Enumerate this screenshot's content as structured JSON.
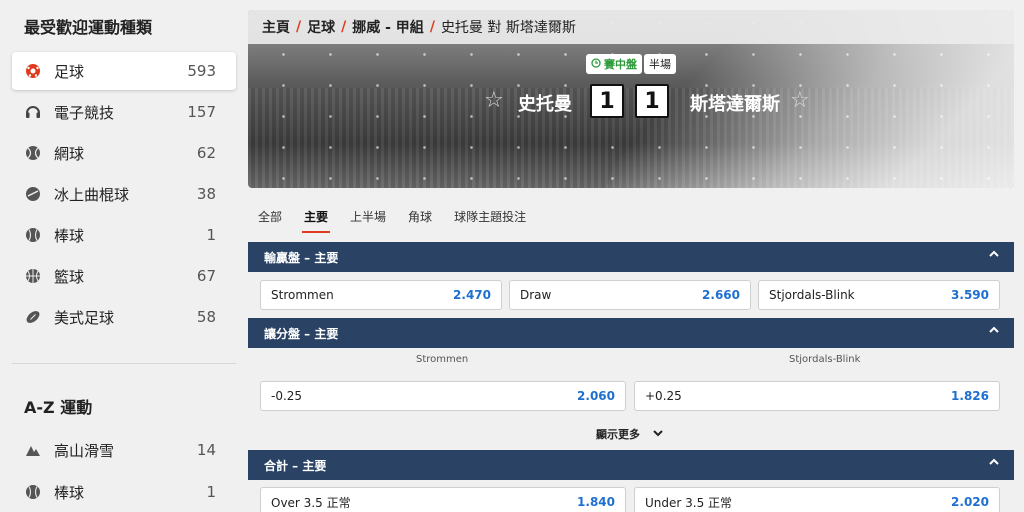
{
  "sidebar": {
    "popular_title": "最受歡迎運動種類",
    "popular": [
      {
        "label": "足球",
        "count": "593",
        "icon": "soccer-ball-icon"
      },
      {
        "label": "電子競技",
        "count": "157",
        "icon": "headset-icon"
      },
      {
        "label": "網球",
        "count": "62",
        "icon": "tennis-ball-icon"
      },
      {
        "label": "冰上曲棍球",
        "count": "38",
        "icon": "ice-hockey-puck-icon"
      },
      {
        "label": "棒球",
        "count": "1",
        "icon": "baseball-icon"
      },
      {
        "label": "籃球",
        "count": "67",
        "icon": "basketball-icon"
      },
      {
        "label": "美式足球",
        "count": "58",
        "icon": "american-football-icon"
      }
    ],
    "az_title": "A-Z 運動",
    "az": [
      {
        "label": "高山滑雪",
        "count": "14",
        "icon": "mountain-icon"
      },
      {
        "label": "棒球",
        "count": "1",
        "icon": "baseball-icon"
      }
    ]
  },
  "breadcrumb": {
    "home": "主頁",
    "sport": "足球",
    "league": "挪威 - 甲組",
    "current": "史托曼 對 斯塔達爾斯"
  },
  "match": {
    "live_label": "賽中盤",
    "period_label": "半場",
    "home_team": "史托曼",
    "away_team": "斯塔達爾斯",
    "home_score": "1",
    "away_score": "1"
  },
  "tabs": [
    "全部",
    "主要",
    "上半場",
    "角球",
    "球隊主題投注"
  ],
  "active_tab_index": 1,
  "markets": {
    "moneyline": {
      "title": "輸贏盤 – 主要",
      "options": [
        {
          "name": "Strommen",
          "odds": "2.470"
        },
        {
          "name": "Draw",
          "odds": "2.660"
        },
        {
          "name": "Stjordals-Blink",
          "odds": "3.590"
        }
      ]
    },
    "handicap": {
      "title": "讓分盤 – 主要",
      "col_home": "Strommen",
      "col_away": "Stjordals-Blink",
      "options": [
        {
          "name": "-0.25",
          "odds": "2.060"
        },
        {
          "name": "+0.25",
          "odds": "1.826"
        }
      ],
      "show_more": "顯示更多"
    },
    "totals": {
      "title": "合計 – 主要",
      "options": [
        {
          "name": "Over 3.5 正常",
          "odds": "1.840"
        },
        {
          "name": "Under 3.5 正常",
          "odds": "2.020"
        }
      ]
    }
  },
  "colors": {
    "accent": "#e03a1e",
    "section_header": "#2a4365",
    "odds_blue": "#1f6fd1",
    "live_green": "#2e9a3c"
  }
}
